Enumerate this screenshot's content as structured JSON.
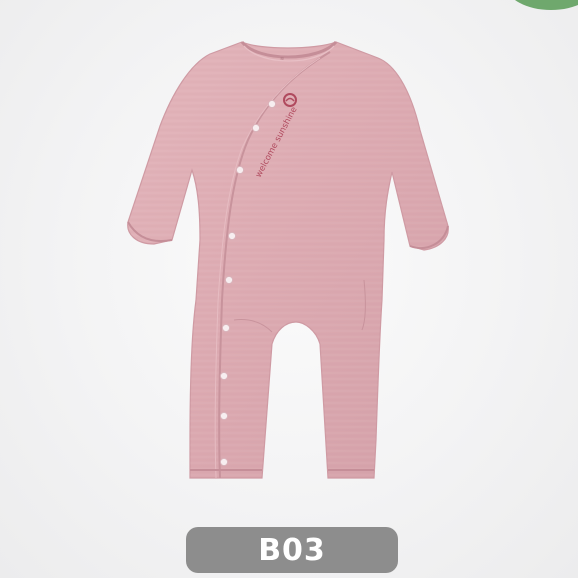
{
  "product": {
    "code": "B03",
    "print_text": "welcome sunshine",
    "garment_color": "#dcaab1",
    "print_color": "#b04a5e",
    "snap_count": 9
  },
  "colors": {
    "badge": "#6fa86d",
    "label_bg": "#8d8d8d",
    "label_text": "#ffffff"
  }
}
